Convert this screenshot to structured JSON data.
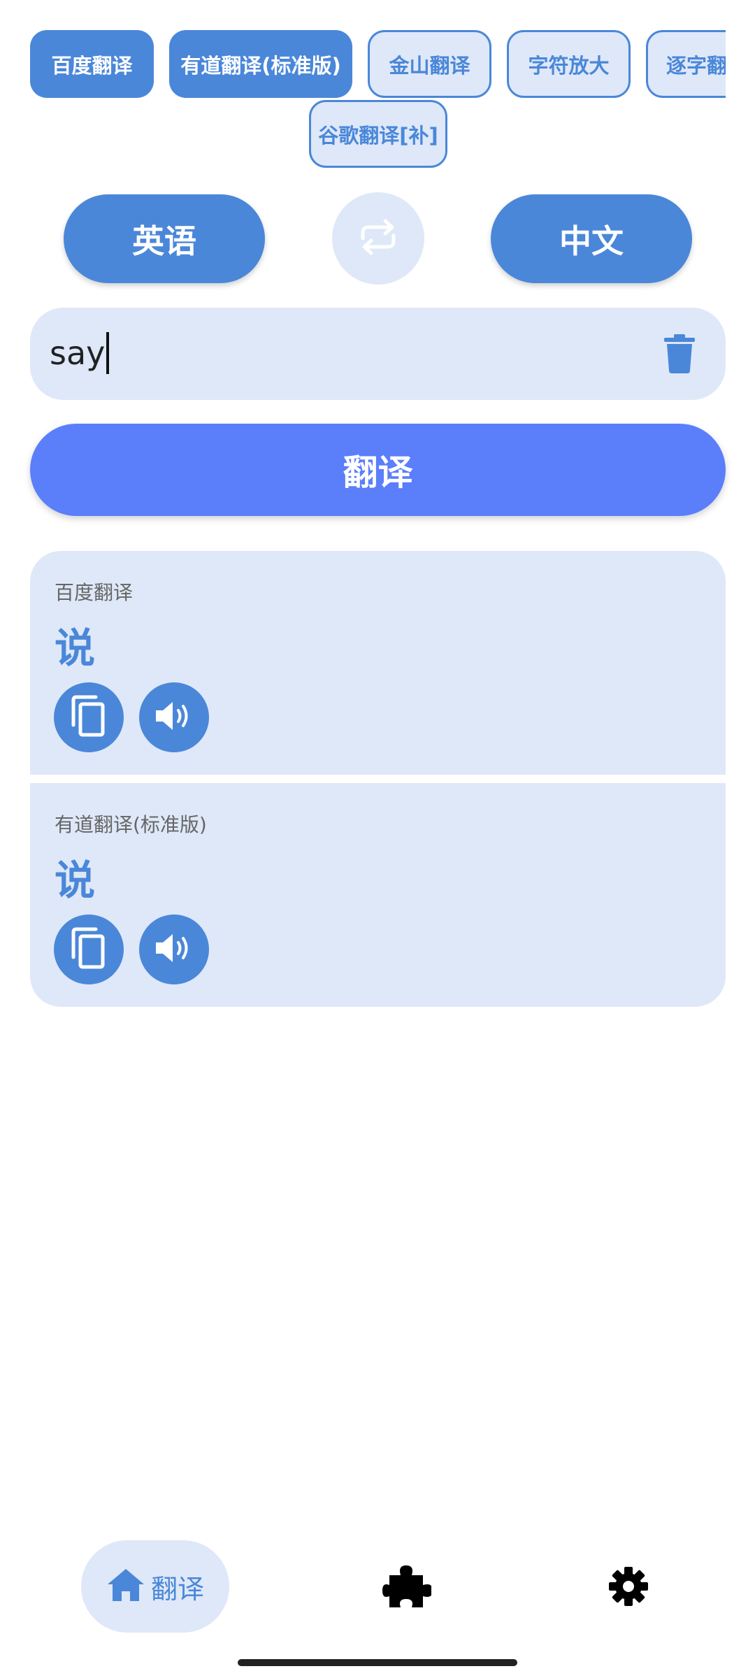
{
  "engines": [
    {
      "label": "百度翻译",
      "selected": true
    },
    {
      "label": "有道翻译(标准版)",
      "selected": true
    },
    {
      "label": "金山翻译",
      "selected": false
    },
    {
      "label": "字符放大",
      "selected": false
    },
    {
      "label": "逐字翻",
      "selected": false
    },
    {
      "label": "谷歌翻译[补]",
      "selected": false
    }
  ],
  "languages": {
    "source": "英语",
    "target": "中文",
    "swap_icon": "swap-icon"
  },
  "input": {
    "value": "say",
    "clear_icon": "trash-icon"
  },
  "translate_button": "翻译",
  "results": [
    {
      "engine": "百度翻译",
      "text": "说"
    },
    {
      "engine": "有道翻译(标准版)",
      "text": "说"
    }
  ],
  "nav": {
    "home_label": "翻译",
    "icons": [
      "home-icon",
      "puzzle-icon",
      "gear-icon"
    ]
  },
  "colors": {
    "accent": "#4A87D9",
    "accent_light": "#DEE8F8",
    "translate_button": "#5B7EFB"
  }
}
